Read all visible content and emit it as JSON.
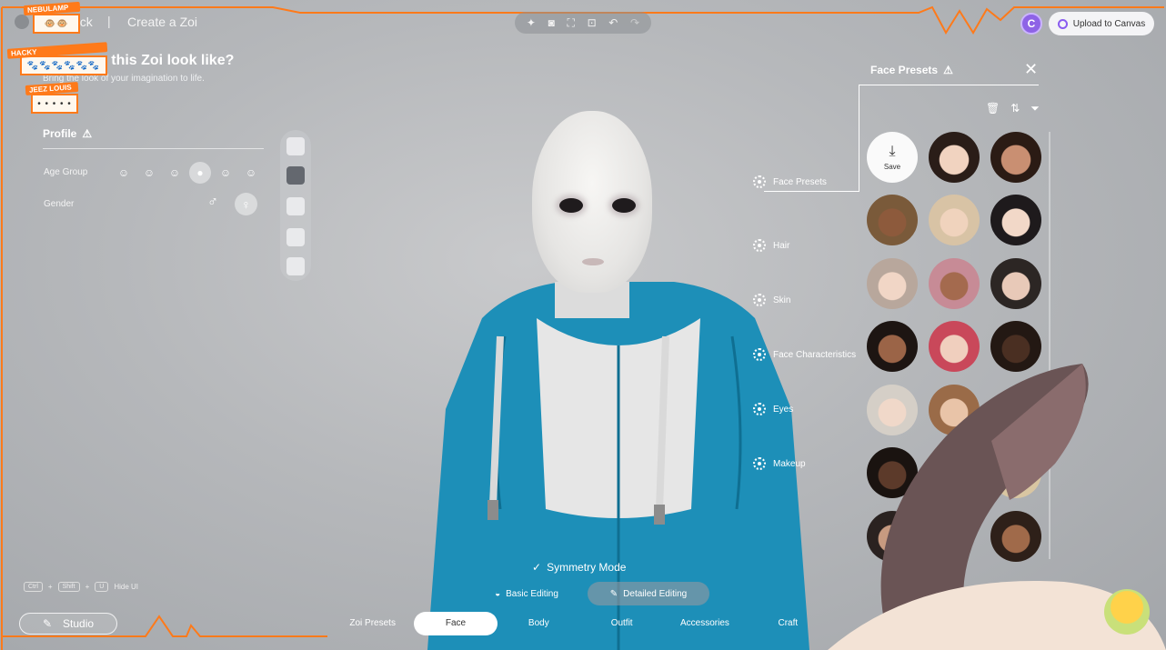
{
  "topbar": {
    "back_label": "ack",
    "separator": "|",
    "title": "Create a Zoi",
    "toolbar_icons": [
      "sparkle-icon",
      "camera-icon",
      "frame-icon",
      "focus-icon",
      "undo-icon",
      "redo-icon"
    ],
    "user_initial": "C",
    "upload_label": "Upload to Canvas"
  },
  "intro": {
    "headline": "es this Zoi look like?",
    "subline": "Bring the look of your imagination to life."
  },
  "stream_overlay": {
    "chips": [
      {
        "badge": "NEBULAMP",
        "text": "🐵🐵"
      },
      {
        "badge": "HACKY",
        "text": "🐾🐾🐾🐾🐾🐾"
      },
      {
        "badge": "JEEZ LOUIS",
        "text": "• • • • •"
      }
    ]
  },
  "profile": {
    "title": "Profile",
    "age_group_label": "Age Group",
    "age_icons": [
      "infant-icon",
      "child-icon",
      "teen-icon",
      "young-adult-icon",
      "adult-icon",
      "elder-icon"
    ],
    "age_selected_index": 3,
    "gender_label": "Gender",
    "gender_male_symbol": "♂",
    "gender_female_symbol": "♀",
    "gender_selected": "female"
  },
  "panel": {
    "title": "Face Presets",
    "close_symbol": "✕",
    "save_label": "Save",
    "categories": [
      "Face Presets",
      "Hair",
      "Skin",
      "Face Characteristics",
      "Eyes",
      "Makeup"
    ]
  },
  "editing": {
    "symmetry_label": "Symmetry Mode",
    "basic_label": "Basic Editing",
    "detailed_label": "Detailed Editing"
  },
  "hide_ui": {
    "keys": [
      "Ctrl",
      "Shift",
      "U"
    ],
    "plus": "+",
    "label": "Hide UI"
  },
  "studio_label": "Studio",
  "tabs": [
    "Zoi Presets",
    "Face",
    "Body",
    "Outfit",
    "Accessories",
    "Craft"
  ],
  "active_tab": "Face",
  "colors": {
    "accent_orange": "#ff7a1a",
    "hoodie_blue": "#1d8fb8",
    "upload_accent": "#8a5cf0"
  }
}
